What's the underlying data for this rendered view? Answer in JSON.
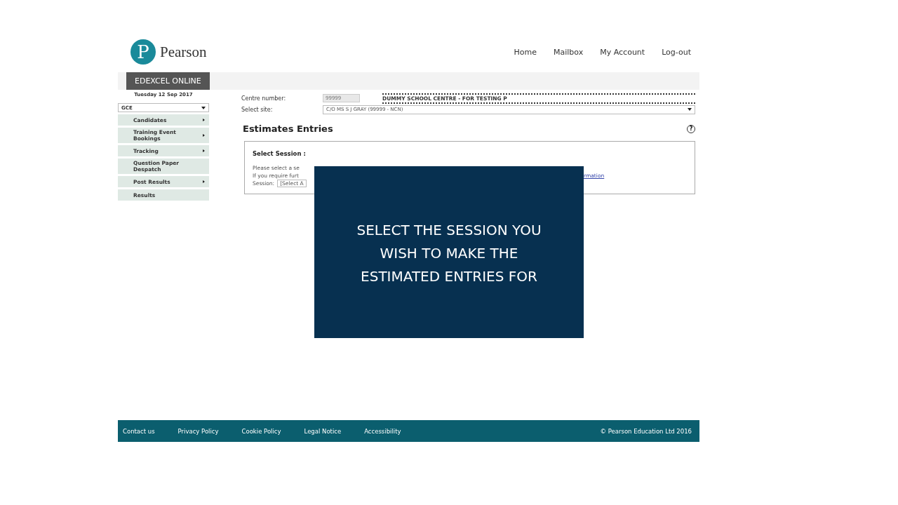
{
  "brand": {
    "logo_letter": "P",
    "name": "Pearson"
  },
  "nav": [
    "Home",
    "Mailbox",
    "My Account",
    "Log-out"
  ],
  "portal_tab": "EDEXCEL ONLINE",
  "sidebar": {
    "date": "Tuesday 12 Sep 2017",
    "qualification": "GCE",
    "items": [
      {
        "label": "Candidates",
        "has_submenu": true
      },
      {
        "label": "Training Event Bookings",
        "has_submenu": true
      },
      {
        "label": "Tracking",
        "has_submenu": true
      },
      {
        "label": "Question Paper Despatch",
        "has_submenu": false
      },
      {
        "label": "Post Results",
        "has_submenu": true
      },
      {
        "label": "Results",
        "has_submenu": false
      }
    ]
  },
  "centre": {
    "number_label": "Centre number:",
    "number": "99999",
    "name": "DUMMY SCHOOL CENTRE - FOR TESTING P",
    "site_label": "Select site:",
    "site": "C/O MS S J GRAY (99999 - NCN)"
  },
  "page_title": "Estimates Entries",
  "help_icon": "?",
  "session_box": {
    "heading": "Select Session :",
    "line_1": "Please select a se",
    "line_2": "If you require furt",
    "link": "rmation",
    "session_label": "Session:",
    "session_value": "[Select A"
  },
  "overlay": {
    "caption": "SELECT THE SESSION YOU WISH TO MAKE THE ESTIMATED ENTRIES FOR"
  },
  "footer": {
    "links": [
      "Contact us",
      "Privacy Policy",
      "Cookie Policy",
      "Legal Notice",
      "Accessibility"
    ],
    "copyright": "© Pearson Education Ltd 2016"
  }
}
